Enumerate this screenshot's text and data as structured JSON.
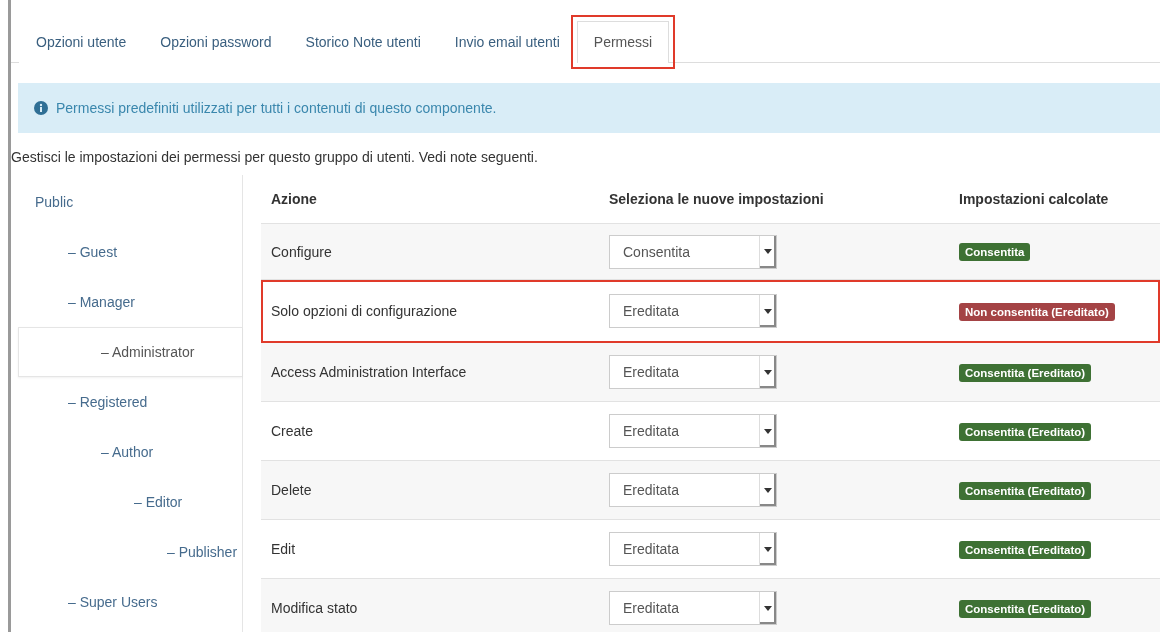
{
  "tabs": [
    {
      "label": "Opzioni utente",
      "selected": false,
      "highlighted": false
    },
    {
      "label": "Opzioni password",
      "selected": false,
      "highlighted": false
    },
    {
      "label": "Storico Note utenti",
      "selected": false,
      "highlighted": false
    },
    {
      "label": "Invio email utenti",
      "selected": false,
      "highlighted": false
    },
    {
      "label": "Permessi",
      "selected": true,
      "highlighted": true
    }
  ],
  "info_alert": {
    "text": "Permessi predefiniti utilizzati per tutti i contenuti di questo componente."
  },
  "description": "Gestisci le impostazioni dei permessi per questo gruppo di utenti. Vedi note seguenti.",
  "groups": [
    {
      "label": "Public",
      "selected": false,
      "children": [
        {
          "label": "– Guest",
          "selected": false
        },
        {
          "label": "– Manager",
          "selected": false,
          "children": [
            {
              "label": "– Administrator",
              "selected": true
            }
          ]
        },
        {
          "label": "– Registered",
          "selected": false,
          "children": [
            {
              "label": "– Author",
              "selected": false,
              "children": [
                {
                  "label": "– Editor",
                  "selected": false,
                  "children": [
                    {
                      "label": "– Publisher",
                      "selected": false
                    }
                  ]
                }
              ]
            }
          ]
        },
        {
          "label": "– Super Users",
          "selected": false
        }
      ]
    }
  ],
  "table": {
    "columns": [
      "Azione",
      "Seleziona le nuove impostazioni",
      "Impostazioni calcolate"
    ],
    "rows": [
      {
        "action": "Configure",
        "setting": "Consentita",
        "calculated": "Consentita",
        "kind": "allowed",
        "highlighted": false
      },
      {
        "action": "Solo opzioni di configurazione",
        "setting": "Ereditata",
        "calculated": "Non consentita (Ereditato)",
        "kind": "denied",
        "highlighted": true
      },
      {
        "action": "Access Administration Interface",
        "setting": "Ereditata",
        "calculated": "Consentita (Ereditato)",
        "kind": "allowed",
        "highlighted": false
      },
      {
        "action": "Create",
        "setting": "Ereditata",
        "calculated": "Consentita (Ereditato)",
        "kind": "allowed",
        "highlighted": false
      },
      {
        "action": "Delete",
        "setting": "Ereditata",
        "calculated": "Consentita (Ereditato)",
        "kind": "allowed",
        "highlighted": false
      },
      {
        "action": "Edit",
        "setting": "Ereditata",
        "calculated": "Consentita (Ereditato)",
        "kind": "allowed",
        "highlighted": false
      },
      {
        "action": "Modifica stato",
        "setting": "Ereditata",
        "calculated": "Consentita (Ereditato)",
        "kind": "allowed",
        "highlighted": false
      }
    ]
  }
}
